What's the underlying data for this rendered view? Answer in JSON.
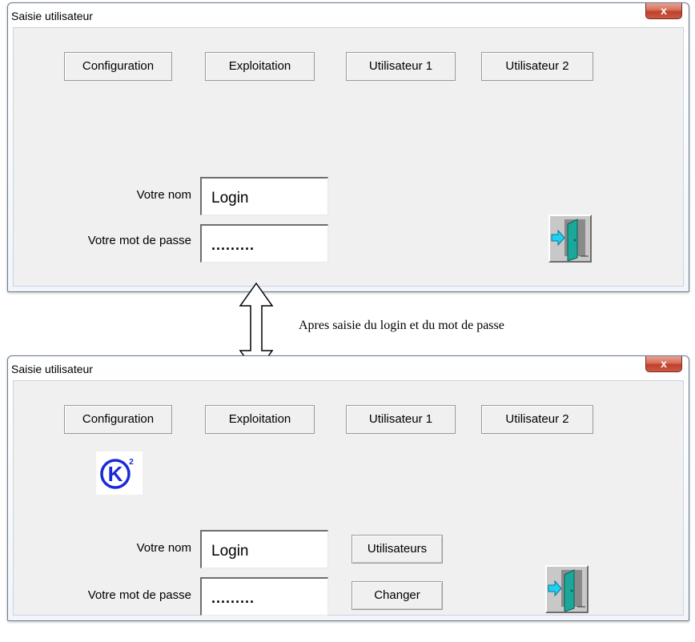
{
  "windows": [
    {
      "title": "Saisie utilisateur",
      "close_label": "x",
      "tabs": [
        "Configuration",
        "Exploitation",
        "Utilisateur 1",
        "Utilisateur 2"
      ],
      "name_label": "Votre nom",
      "name_value": "Login",
      "password_label": "Votre mot de passe",
      "password_value": "........."
    },
    {
      "title": "Saisie utilisateur",
      "close_label": "x",
      "tabs": [
        "Configuration",
        "Exploitation",
        "Utilisateur 1",
        "Utilisateur 2"
      ],
      "name_label": "Votre nom",
      "name_value": "Login",
      "password_label": "Votre mot de passe",
      "password_value": ".........",
      "users_button": "Utilisateurs",
      "change_button": "Changer",
      "logo_text": "K",
      "logo_superscript": "2"
    }
  ],
  "annotation": "Apres saisie du login et du mot de passe",
  "icons": {
    "exit": "exit-door-icon",
    "logo": "k2-logo",
    "arrow": "double-arrow-icon"
  },
  "colors": {
    "logo_blue": "#1a2ad8",
    "door_teal": "#1aa89a",
    "arrow_cyan": "#20d0f0",
    "close_red": "#c8472f"
  }
}
